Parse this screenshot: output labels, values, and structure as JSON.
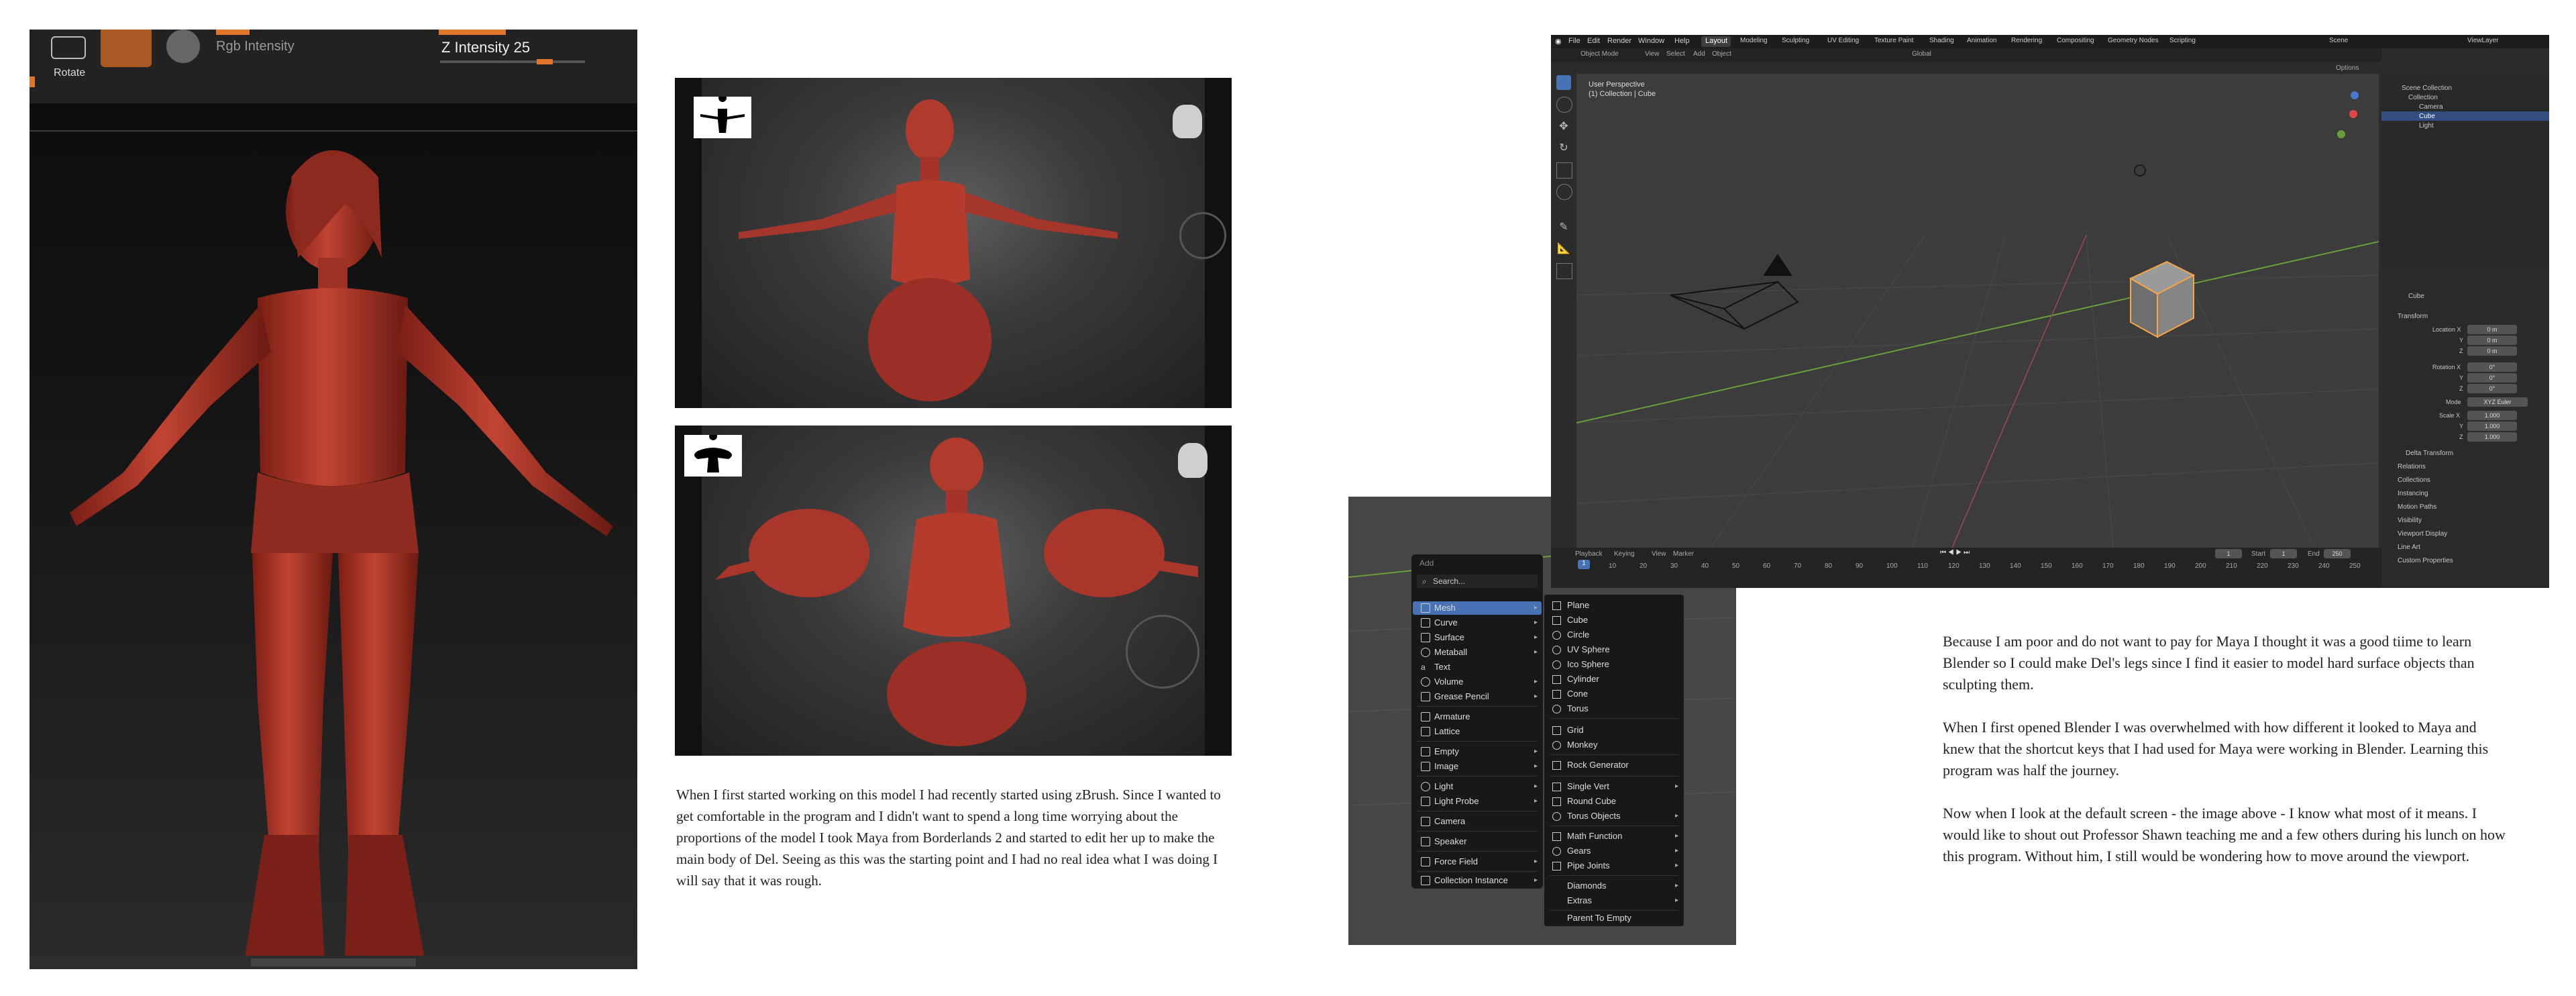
{
  "zbrush_panel": {
    "tool_button": "Rotate",
    "rgb_intensity_label": "Rgb Intensity",
    "z_intensity_label": "Z Intensity 25"
  },
  "caption_left": "When I first started working on this model I had recently started using zBrush. Since I wanted to get comfortable in the program and I didn't want to spend a long time worrying about the proportions of the model I took Maya from Borderlands 2 and started to edit her up to make the main body of Del. Seeing as this was the starting point and I had no real idea what I was doing I will say that it was rough.",
  "blender": {
    "menus": [
      "File",
      "Edit",
      "Render",
      "Window",
      "Help"
    ],
    "workspaces": [
      "Layout",
      "Modeling",
      "Sculpting",
      "UV Editing",
      "Texture Paint",
      "Shading",
      "Animation",
      "Rendering",
      "Compositing",
      "Geometry Nodes",
      "Scripting"
    ],
    "mode": "Object Mode",
    "header_menus": [
      "View",
      "Select",
      "Add",
      "Object"
    ],
    "orientation": "Global",
    "scene": "Scene",
    "view_layer": "ViewLayer",
    "viewport_info_1": "User Perspective",
    "viewport_info_2": "(1) Collection | Cube",
    "outliner_items": [
      "Scene Collection",
      "Collection",
      "Camera",
      "Cube",
      "Light"
    ],
    "props_object": "Cube",
    "props_sections": [
      "Transform",
      "Delta Transform",
      "Relations",
      "Collections",
      "Instancing",
      "Motion Paths",
      "Visibility",
      "Viewport Display",
      "Line Art",
      "Custom Properties"
    ],
    "location_label": "Location X",
    "rotation_label": "Rotation X",
    "scale_label": "Scale X",
    "mode_label": "Mode",
    "rotation_mode": "XYZ Euler",
    "axis_y": "Y",
    "axis_z": "Z",
    "location_vals": [
      "0 m",
      "0 m",
      "0 m"
    ],
    "rotation_vals": [
      "0°",
      "0°",
      "0°"
    ],
    "scale_vals": [
      "1.000",
      "1.000",
      "1.000"
    ],
    "timeline_menus": [
      "Playback",
      "Keying",
      "View",
      "Marker"
    ],
    "timeline_current": "1",
    "timeline_start_label": "Start",
    "timeline_start": "1",
    "timeline_end_label": "End",
    "timeline_end": "250",
    "options_label": "Options",
    "frame_numbers": [
      "10",
      "20",
      "30",
      "40",
      "50",
      "60",
      "70",
      "80",
      "90",
      "100",
      "110",
      "120",
      "130",
      "140",
      "150",
      "160",
      "170",
      "180",
      "190",
      "200",
      "210",
      "220",
      "230",
      "240",
      "250"
    ]
  },
  "add_menu": {
    "title": "Add",
    "search": "Search...",
    "items": [
      "Mesh",
      "Curve",
      "Surface",
      "Metaball",
      "Text",
      "Volume",
      "Grease Pencil",
      "Armature",
      "Lattice",
      "Empty",
      "Image",
      "Light",
      "Light Probe",
      "Camera",
      "Speaker",
      "Force Field",
      "Collection Instance"
    ],
    "mesh_items": [
      "Plane",
      "Cube",
      "Circle",
      "UV Sphere",
      "Ico Sphere",
      "Cylinder",
      "Cone",
      "Torus",
      "Grid",
      "Monkey",
      "Rock Generator",
      "Single Vert",
      "Round Cube",
      "Torus Objects",
      "Math Function",
      "Gears",
      "Pipe Joints",
      "Diamonds",
      "Extras",
      "Parent To Empty"
    ]
  },
  "paragraphs": [
    "Because I am poor and do not want to pay for Maya I thought it was a good tiime to learn Blender so I could make Del's legs since I find it easier to model hard surface objects than sculpting them.",
    "When I first opened Blender I was overwhelmed with how different it looked to Maya and knew that the shortcut keys that I had used for Maya were working in Blender. Learning this program was half the journey.",
    "Now when I look at the default screen - the image above - I know what most of it means. I would like to shout out Professor Shawn teaching me and a few others during his lunch on how this program. Without him, I still would be wondering how to move around the viewport."
  ],
  "colors": {
    "model_red": "#b5382b",
    "zbrush_orange": "#e0752b",
    "blender_orange": "#f5a544"
  }
}
